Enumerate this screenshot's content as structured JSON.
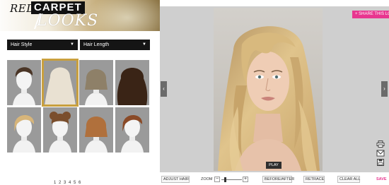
{
  "brand": {
    "red": "RED",
    "carpet": "CARPET",
    "looks": "LOOKS"
  },
  "dropdowns": {
    "hair_style": "Hair Style",
    "hair_length": "Hair Length",
    "arrow": "▼"
  },
  "thumbnails": [
    {
      "label": "short brown pixie",
      "hair": "#4a3526",
      "style": "short",
      "selected": false
    },
    {
      "label": "long platinum wavy",
      "hair": "#e9e1d2",
      "style": "long",
      "selected": true
    },
    {
      "label": "chin bob ash",
      "hair": "#8e8068",
      "style": "bob",
      "selected": false
    },
    {
      "label": "long dark curly",
      "hair": "#3a2416",
      "style": "curly",
      "selected": false
    },
    {
      "label": "blonde side swept",
      "hair": "#d7b57a",
      "style": "side",
      "selected": false
    },
    {
      "label": "brown updo curls",
      "hair": "#7a4e2c",
      "style": "updo",
      "selected": false
    },
    {
      "label": "copper bob",
      "hair": "#b0703c",
      "style": "bob",
      "selected": false
    },
    {
      "label": "auburn short",
      "hair": "#8a4a27",
      "style": "side",
      "selected": false
    }
  ],
  "pager_text": "1 2 3 4 5 6",
  "share_button": "+ SHARE THIS LOOK",
  "nav": {
    "prev": "‹",
    "next": "›"
  },
  "play_button": "PLAY",
  "toolbar": {
    "adjust_hair": "ADJUST HAIR",
    "zoom": "ZOOM",
    "zoom_minus": "−",
    "zoom_plus": "+",
    "before_after": "BEFORE/AFTER",
    "retrace": "RETRACE",
    "clear_all": "CLEAR ALL",
    "save": "SAVE"
  },
  "side_icons": [
    "print-icon",
    "email-icon",
    "save-disk-icon"
  ],
  "colors": {
    "accent_pink": "#e8368f",
    "selected_border": "#c9a03e",
    "dropdown_bg": "#151515"
  }
}
